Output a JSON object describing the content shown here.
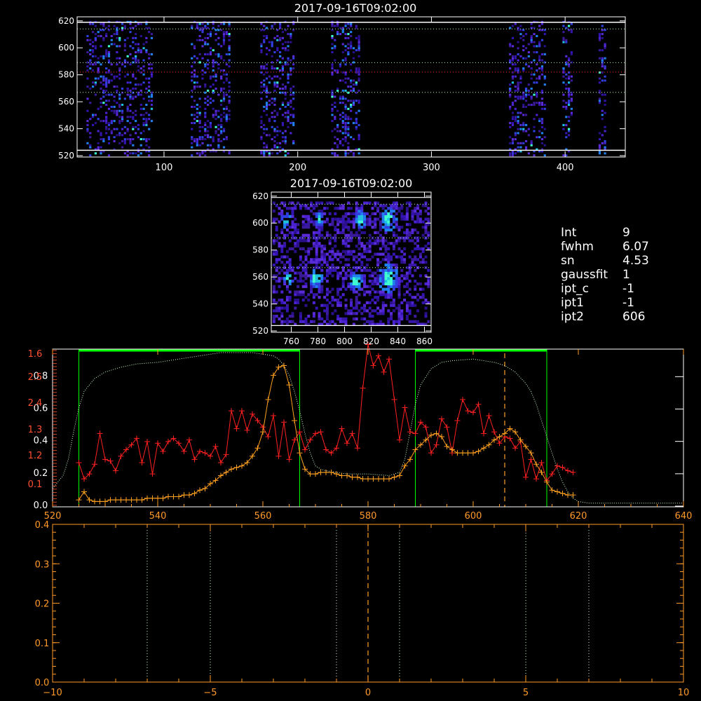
{
  "panel_top": {
    "title": "2017-09-16T09:02:00"
  },
  "panel_mid": {
    "title": "2017-09-16T09:02:00"
  },
  "info": [
    {
      "key": "Int",
      "value": "9"
    },
    {
      "key": "fwhm",
      "value": "6.07"
    },
    {
      "key": "sn",
      "value": "4.53"
    },
    {
      "key": "gaussfit",
      "value": "1"
    },
    {
      "key": "ipt_c",
      "value": "-1"
    },
    {
      "key": "ipt1",
      "value": "-1"
    },
    {
      "key": "ipt2",
      "value": "606"
    }
  ],
  "colors": {
    "axis": "#ffffff",
    "axis_red": "#ff5030",
    "axis_orange": "#ff9a2a",
    "red_series": "#ff2020",
    "orange_series": "#ffa020",
    "green": "#00ff00",
    "dotted_green": "#aaffaa",
    "dotted_white": "#d0ffd0"
  },
  "chart_data": [
    {
      "type": "heatmap",
      "title": "2017-09-16T09:02:00",
      "xlim": [
        35,
        445
      ],
      "ylim": [
        519,
        623
      ],
      "xticks": [
        100,
        200,
        300,
        400
      ],
      "yticks": [
        520,
        540,
        560,
        580,
        600,
        620
      ],
      "bright_columns": [
        [
          42,
          90
        ],
        [
          120,
          148
        ],
        [
          172,
          196
        ],
        [
          225,
          245
        ],
        [
          358,
          385
        ],
        [
          398,
          405
        ],
        [
          425,
          430
        ]
      ],
      "hlines_solid": [
        524,
        619
      ],
      "hlines_dotted": [
        567,
        589,
        614
      ],
      "hline_red": 582
    },
    {
      "type": "heatmap",
      "title": "2017-09-16T09:02:00",
      "xlim": [
        745,
        865
      ],
      "ylim": [
        519,
        623
      ],
      "xticks": [
        760,
        780,
        800,
        820,
        840,
        860
      ],
      "yticks": [
        520,
        540,
        560,
        580,
        600,
        620
      ],
      "hlines_solid": [
        524,
        619
      ],
      "hlines_dotted": [
        567,
        589,
        614
      ]
    },
    {
      "type": "line",
      "xlim": [
        520,
        640
      ],
      "xticks": [
        520,
        540,
        560,
        580,
        600,
        620,
        640
      ],
      "y_left_white": [
        0.0,
        0.2,
        0.4,
        0.6,
        0.8
      ],
      "y_left_white_labels": [
        "0.0",
        "0.2",
        "0.4",
        "0.6",
        "0.8"
      ],
      "y_left_red": [
        0.1,
        1.2,
        1.3,
        2.4,
        2.5,
        1.6
      ],
      "y_left_red_labels": [
        "0.1",
        "1.2",
        "1.3",
        "2.4",
        "2.5",
        "1.6"
      ],
      "windows": [
        [
          525,
          567
        ],
        [
          589,
          614
        ]
      ],
      "vline_dashed": 606,
      "series": [
        {
          "x": [
            525,
            526,
            527,
            528,
            529,
            530,
            531,
            532,
            533,
            534,
            535,
            536,
            537,
            538,
            539,
            540,
            541,
            542,
            543,
            544,
            545,
            546,
            547,
            548,
            549,
            550,
            551,
            552,
            553,
            554,
            555,
            556,
            557,
            558,
            559,
            560,
            561,
            562,
            563,
            564,
            565,
            566,
            567,
            568,
            569,
            570,
            571,
            572,
            573,
            574,
            575,
            576,
            577,
            578,
            579,
            580,
            581,
            582,
            583,
            584,
            585,
            586,
            587,
            588,
            589,
            590,
            591,
            592,
            593,
            594,
            595,
            596,
            597,
            598,
            599,
            600,
            601,
            602,
            603,
            604,
            605,
            606,
            607,
            608,
            609,
            610,
            611,
            612,
            613,
            614,
            615,
            616,
            617,
            618,
            619
          ],
          "values": [
            0.26,
            0.16,
            0.19,
            0.25,
            0.44,
            0.28,
            0.27,
            0.21,
            0.3,
            0.34,
            0.37,
            0.41,
            0.26,
            0.39,
            0.19,
            0.38,
            0.33,
            0.39,
            0.41,
            0.38,
            0.33,
            0.4,
            0.28,
            0.33,
            0.32,
            0.3,
            0.36,
            0.26,
            0.31,
            0.58,
            0.47,
            0.58,
            0.46,
            0.56,
            0.52,
            0.48,
            0.42,
            0.55,
            0.3,
            0.51,
            0.28,
            0.4,
            0.45,
            0.34,
            0.4,
            0.44,
            0.45,
            0.34,
            0.32,
            0.35,
            0.47,
            0.38,
            0.44,
            0.35,
            0.72,
            0.99,
            0.86,
            0.92,
            0.82,
            0.9,
            0.65,
            0.4,
            0.6,
            0.45,
            0.44,
            0.51,
            0.48,
            0.32,
            0.37,
            0.53,
            0.48,
            0.32,
            0.52,
            0.65,
            0.58,
            0.57,
            0.62,
            0.44,
            0.55,
            0.45,
            0.38,
            0.42,
            0.41,
            0.35,
            0.39,
            0.17,
            0.28,
            0.16,
            0.26,
            0.15,
            0.19,
            0.24,
            0.23,
            0.21,
            0.2
          ]
        },
        {
          "x": [
            525,
            526,
            527,
            528,
            529,
            530,
            531,
            532,
            533,
            534,
            535,
            536,
            537,
            538,
            539,
            540,
            541,
            542,
            543,
            544,
            545,
            546,
            547,
            548,
            549,
            550,
            551,
            552,
            553,
            554,
            555,
            556,
            557,
            558,
            559,
            560,
            561,
            562,
            563,
            564,
            565,
            566,
            567,
            568,
            569,
            570,
            571,
            572,
            573,
            574,
            575,
            576,
            577,
            578,
            579,
            580,
            581,
            582,
            583,
            584,
            585,
            586,
            587,
            588,
            589,
            590,
            591,
            592,
            593,
            594,
            595,
            596,
            597,
            598,
            599,
            600,
            601,
            602,
            603,
            604,
            605,
            606,
            607,
            608,
            609,
            610,
            611,
            612,
            613,
            614,
            615,
            616,
            617,
            618,
            619
          ],
          "values": [
            0.03,
            0.08,
            0.03,
            0.02,
            0.02,
            0.02,
            0.03,
            0.03,
            0.03,
            0.03,
            0.03,
            0.03,
            0.03,
            0.04,
            0.04,
            0.04,
            0.04,
            0.05,
            0.05,
            0.05,
            0.06,
            0.06,
            0.07,
            0.09,
            0.1,
            0.13,
            0.15,
            0.18,
            0.2,
            0.22,
            0.23,
            0.24,
            0.26,
            0.3,
            0.35,
            0.45,
            0.65,
            0.8,
            0.85,
            0.86,
            0.74,
            0.52,
            0.32,
            0.22,
            0.19,
            0.19,
            0.2,
            0.2,
            0.2,
            0.19,
            0.18,
            0.18,
            0.17,
            0.17,
            0.16,
            0.16,
            0.16,
            0.16,
            0.16,
            0.16,
            0.17,
            0.18,
            0.24,
            0.28,
            0.34,
            0.37,
            0.4,
            0.43,
            0.44,
            0.42,
            0.36,
            0.34,
            0.32,
            0.32,
            0.32,
            0.32,
            0.33,
            0.35,
            0.37,
            0.4,
            0.42,
            0.44,
            0.47,
            0.45,
            0.4,
            0.36,
            0.32,
            0.25,
            0.2,
            0.14,
            0.09,
            0.08,
            0.07,
            0.06,
            0.06
          ]
        },
        {
          "x": [
            520,
            522,
            523,
            524,
            525,
            526,
            528,
            530,
            533,
            536,
            540,
            544,
            548,
            552,
            556,
            558,
            560,
            562,
            563,
            564,
            565,
            566,
            567,
            568,
            569,
            570,
            571,
            572,
            574,
            576,
            580,
            584,
            586,
            587,
            588,
            589,
            590,
            592,
            594,
            596,
            600,
            604,
            606,
            608,
            610,
            611,
            612,
            613,
            614,
            615,
            616,
            617,
            618,
            619,
            620,
            622,
            625,
            630,
            635,
            640
          ],
          "values": [
            0.1,
            0.18,
            0.28,
            0.45,
            0.6,
            0.7,
            0.78,
            0.82,
            0.85,
            0.87,
            0.88,
            0.9,
            0.92,
            0.94,
            0.94,
            0.94,
            0.93,
            0.92,
            0.9,
            0.86,
            0.8,
            0.7,
            0.58,
            0.44,
            0.32,
            0.24,
            0.22,
            0.21,
            0.2,
            0.19,
            0.19,
            0.18,
            0.2,
            0.28,
            0.45,
            0.62,
            0.74,
            0.84,
            0.88,
            0.89,
            0.9,
            0.88,
            0.86,
            0.82,
            0.75,
            0.7,
            0.62,
            0.52,
            0.42,
            0.32,
            0.22,
            0.14,
            0.08,
            0.04,
            0.02,
            0.01,
            0.01,
            0.01,
            0.01,
            0.01
          ]
        }
      ]
    },
    {
      "type": "line",
      "xlim": [
        -10,
        10
      ],
      "ylim": [
        0.0,
        0.4
      ],
      "xticks": [
        -10,
        -5,
        0,
        5,
        10
      ],
      "xtick_labels": [
        "−10",
        "−5",
        "0",
        "5",
        "10"
      ],
      "yticks": [
        0.0,
        0.1,
        0.2,
        0.3,
        0.4
      ],
      "ytick_labels": [
        "0.0",
        "0.1",
        "0.2",
        "0.3",
        "0.4"
      ],
      "vlines_dotted": [
        -7,
        -5,
        -1,
        1,
        5,
        7
      ],
      "vline_dashed": 0
    }
  ]
}
